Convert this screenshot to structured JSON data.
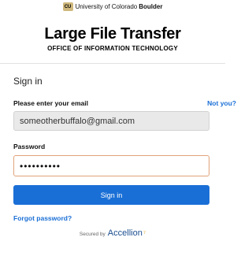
{
  "header": {
    "university_prefix": "University of Colorado",
    "university_bold": "Boulder",
    "logo_text": "CU",
    "app_title": "Large File Transfer",
    "app_subtitle": "OFFICE OF INFORMATION TECHNOLOGY"
  },
  "form": {
    "heading": "Sign in",
    "email_label": "Please enter your email",
    "not_you_link": "Not you?",
    "email_value": "someotherbuffalo@gmail.com",
    "password_label": "Password",
    "password_value": "••••••••••",
    "signin_button": "Sign in",
    "forgot_link": "Forgot password?"
  },
  "footer": {
    "secured_by": "Secured by",
    "brand": "Accellion"
  },
  "colors": {
    "accent": "#1a6fd6",
    "focus_border": "#e0a37a",
    "cu_gold": "#cfb87c"
  }
}
